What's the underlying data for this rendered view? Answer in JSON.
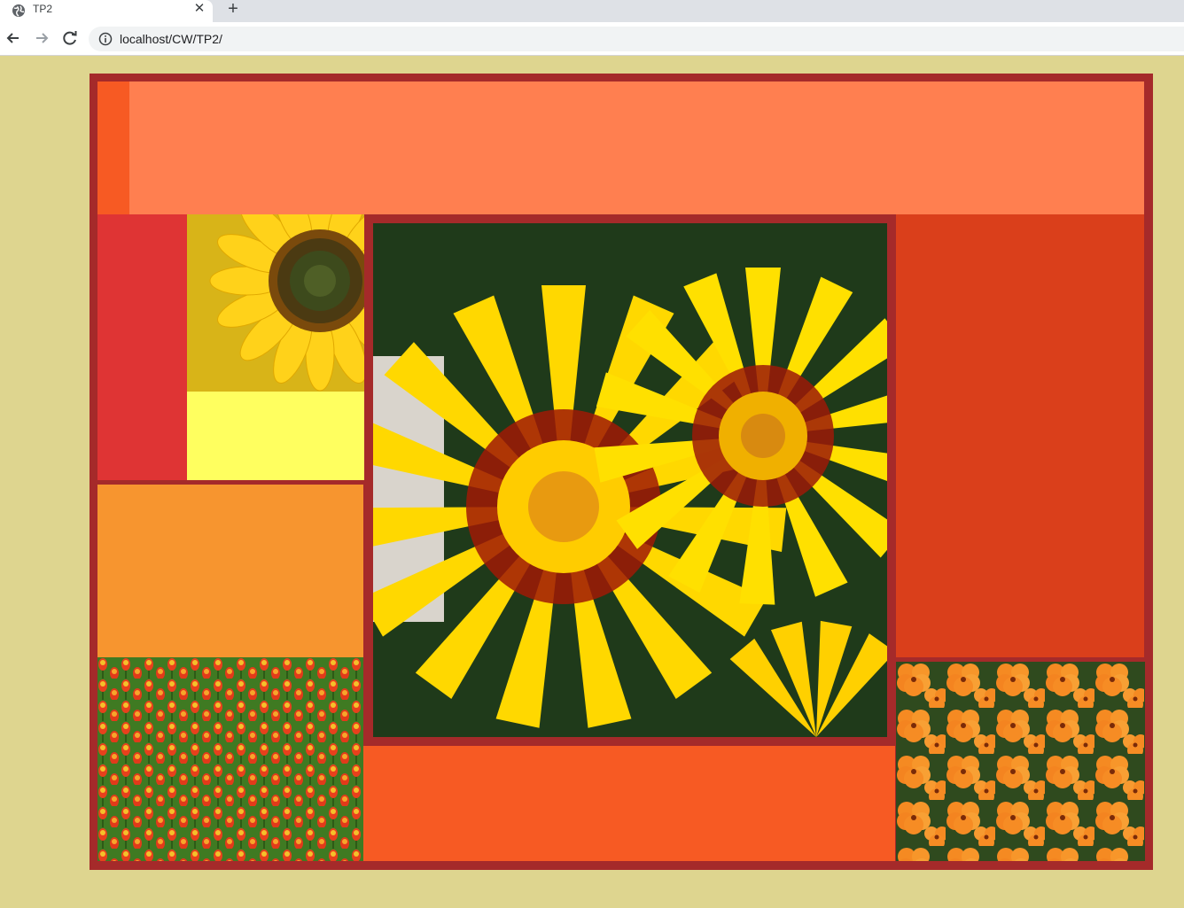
{
  "browser": {
    "tab_title": "TP2",
    "url": "localhost/CW/TP2/",
    "icons": {
      "favicon": "globe-icon",
      "close": "close-icon",
      "new_tab": "plus-icon",
      "back": "back-arrow-icon",
      "forward": "forward-arrow-icon",
      "reload": "reload-icon",
      "site_info": "info-icon"
    }
  },
  "colors": {
    "page_background": "#ded58f",
    "frame": "#a52a2a",
    "header": "#ff7f50",
    "header_strip": "#f75a23",
    "left_red_block": "#df3434",
    "yellow_block": "#ffff5f",
    "orange_block": "#f7952f",
    "right_block": "#da3f1b",
    "bottom_center_block": "#f75a23"
  },
  "images": {
    "sunflower": "sunflower-photo",
    "gazania": "gazania-flowers-photo",
    "tulips": "tulip-field-photo",
    "pansies": "orange-pansies-photo"
  }
}
